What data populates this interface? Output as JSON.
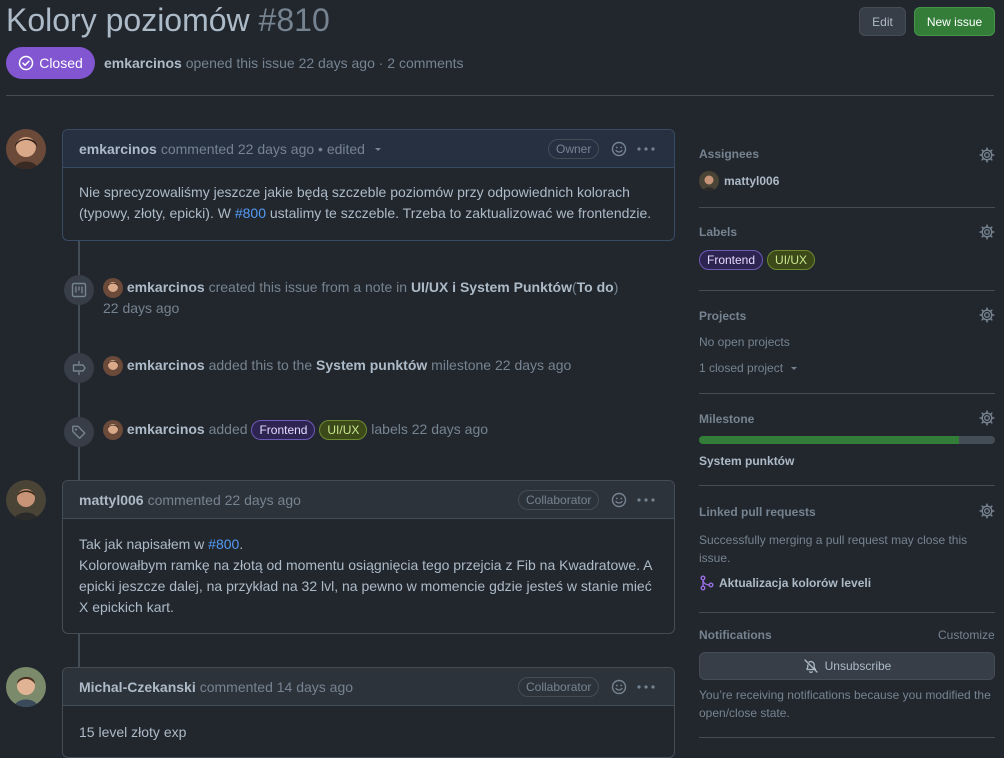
{
  "issue": {
    "title": "Kolory poziomów",
    "number": "#810",
    "state": "Closed",
    "author": "emkarcinos",
    "meta_rest": "opened this issue 22 days ago · 2 comments"
  },
  "header": {
    "edit_label": "Edit",
    "new_issue_label": "New issue"
  },
  "comments": [
    {
      "author": "emkarcinos",
      "meta": "commented 22 days ago • edited",
      "role": "Owner",
      "body_1": "Nie sprecyzowaliśmy jeszcze jakie będą szczeble poziomów przy odpowiednich kolorach",
      "body_2_a": "(typowy, złoty, epicki). W ",
      "body_2_link": "#800",
      "body_2_b": " ustalimy te szczeble. Trzeba to zaktualizować we frontendzie."
    },
    {
      "author": "mattyl006",
      "meta": "commented 22 days ago",
      "role": "Collaborator",
      "body_1_a": "Tak jak napisałem w ",
      "body_1_link": "#800",
      "body_1_b": ".",
      "body_2": "Kolorowałbym ramkę na złotą od momentu osiągnięcia tego przejcia z Fib na Kwadratowe. A",
      "body_3": "epicki jeszcze dalej, na przykład na 32 lvl, na pewno w momencie gdzie jesteś w stanie mieć",
      "body_4": "X epickich kart."
    },
    {
      "author": "Michal-Czekanski",
      "meta": "commented 14 days ago",
      "role": "Collaborator",
      "body_1": "15 level złoty exp"
    }
  ],
  "events": [
    {
      "actor": "emkarcinos",
      "text_a": "created this issue from a note in",
      "project": "UI/UX i System Punktów",
      "column_open": "(",
      "column": "To do",
      "column_close": ")",
      "time": "22 days ago"
    },
    {
      "actor": "emkarcinos",
      "text_a": "added this to the",
      "milestone": "System punktów",
      "text_b": "milestone 22 days ago"
    },
    {
      "actor": "emkarcinos",
      "text_a": "added",
      "label_1": "Frontend",
      "label_2": "UI/UX",
      "text_b": "labels 22 days ago"
    }
  ],
  "sidebar": {
    "assignees_title": "Assignees",
    "assignee": "mattyl006",
    "labels_title": "Labels",
    "labels": [
      "Frontend",
      "UI/UX"
    ],
    "projects_title": "Projects",
    "no_open_projects": "No open projects",
    "closed_projects": "1 closed project",
    "milestone_title": "Milestone",
    "milestone_progress_percent": 88,
    "milestone_name": "System punktów",
    "linked_pr_title": "Linked pull requests",
    "linked_pr_text_1": "Successfully merging a pull request may close this",
    "linked_pr_text_2": "issue.",
    "linked_pr_name": "Aktualizacja kolorów leveli",
    "notifications_title": "Notifications",
    "customize": "Customize",
    "unsubscribe": "Unsubscribe",
    "notif_text_1": "You’re receiving notifications because you modified the",
    "notif_text_2": "open/close state."
  },
  "colors": {
    "background": "#22272e",
    "closed_badge": "#8256d0",
    "new_issue_button": "#347d39",
    "link": "#539bf5",
    "milestone_bar": "#347d39"
  }
}
